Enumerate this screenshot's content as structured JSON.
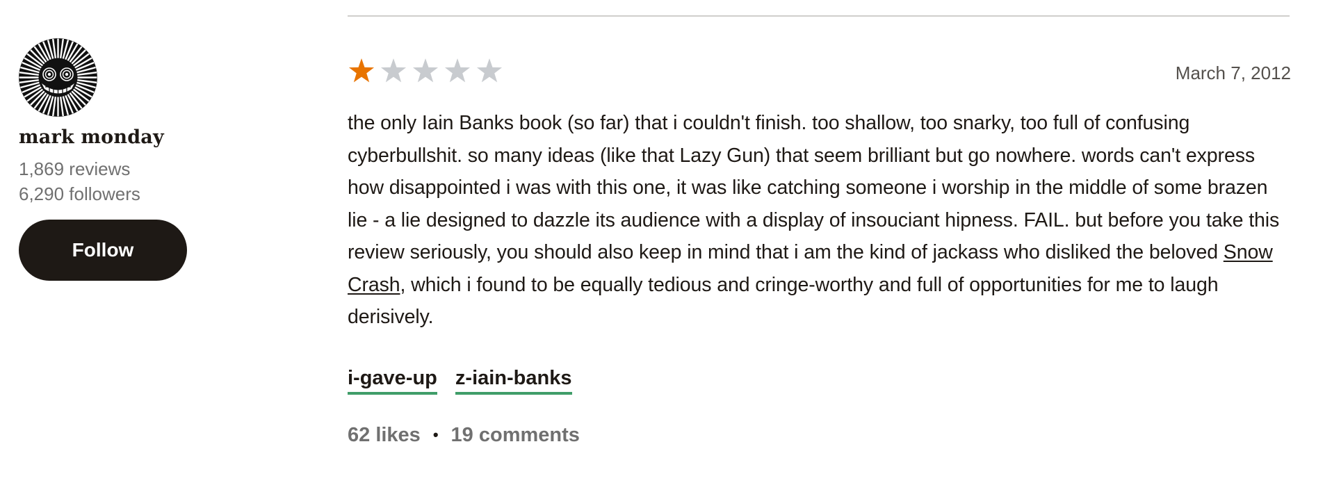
{
  "reviewer": {
    "avatar_icon": "cheshire-cat-sunburst-avatar",
    "name": "mark monday",
    "reviews": "1,869 reviews",
    "followers": "6,290 followers",
    "follow_label": "Follow"
  },
  "review": {
    "rating": 1,
    "rating_max": 5,
    "star_filled_color": "#e87400",
    "star_empty_color": "#c8cbcf",
    "date": "March 7, 2012",
    "text_before_link": "the only Iain Banks book (so far) that i couldn't finish. too shallow, too snarky, too full of confusing cyberbullshit. so many ideas (like that Lazy Gun) that seem brilliant but go nowhere. words can't express how disappointed i was with this one, it was like catching someone i worship in the middle of some brazen lie - a lie designed to dazzle its audience with a display of insouciant hipness. FAIL. but before you take this review seriously, you should also keep in mind that i am the kind of jackass who disliked the beloved ",
    "link_text": "Snow Crash",
    "text_after_link": ", which i found to be equally tedious and cringe-worthy and full of opportunities for me to laugh derisively.",
    "shelves": [
      "i-gave-up",
      "z-iain-banks"
    ],
    "shelf_underline_color": "#409d69",
    "likes": "62 likes",
    "separator": "•",
    "comments": "19 comments"
  }
}
